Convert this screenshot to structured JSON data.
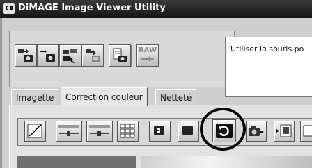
{
  "window": {
    "title": "DiMAGE Image Viewer Utility"
  },
  "toolbar": {
    "buttons": [
      {
        "name": "acquire-camera-button",
        "icon": "camera-transfer-icon"
      },
      {
        "name": "camera-import-button",
        "icon": "camera-import-icon"
      },
      {
        "name": "camera-export-button",
        "icon": "camera-export-icon"
      },
      {
        "name": "camera-batch-button",
        "icon": "camera-batch-icon"
      },
      {
        "name": "camera-view-button",
        "icon": "camera-view-icon"
      },
      {
        "name": "raw-button",
        "icon": "raw-icon",
        "label": "RAW"
      }
    ],
    "message": "Utiliser la souris po"
  },
  "tabs": [
    {
      "label": "Imagette",
      "active": false
    },
    {
      "label": "Correction couleur",
      "active": true
    },
    {
      "label": "Netteté",
      "active": false
    }
  ],
  "correction_toolbar": {
    "buttons": [
      {
        "name": "tone-curve-button",
        "icon": "tone-curve-icon"
      },
      {
        "name": "brightness-slider-button",
        "icon": "slider-icon"
      },
      {
        "name": "contrast-slider-button",
        "icon": "slider-icon"
      },
      {
        "name": "variations-button",
        "icon": "variations-grid-icon"
      },
      {
        "name": "undo-button",
        "icon": "undo-icon"
      },
      {
        "name": "redo-button",
        "icon": "redo-icon"
      },
      {
        "name": "reset-button",
        "icon": "reset-arrow-icon",
        "highlighted": true
      },
      {
        "name": "snapshot-button",
        "icon": "camera-icon"
      },
      {
        "name": "export-button",
        "icon": "export-icon"
      },
      {
        "name": "extra-button",
        "icon": "window-icon"
      }
    ]
  },
  "colors": {
    "titlebar": "#1f1f1f",
    "highlight_ring": "#050505"
  }
}
